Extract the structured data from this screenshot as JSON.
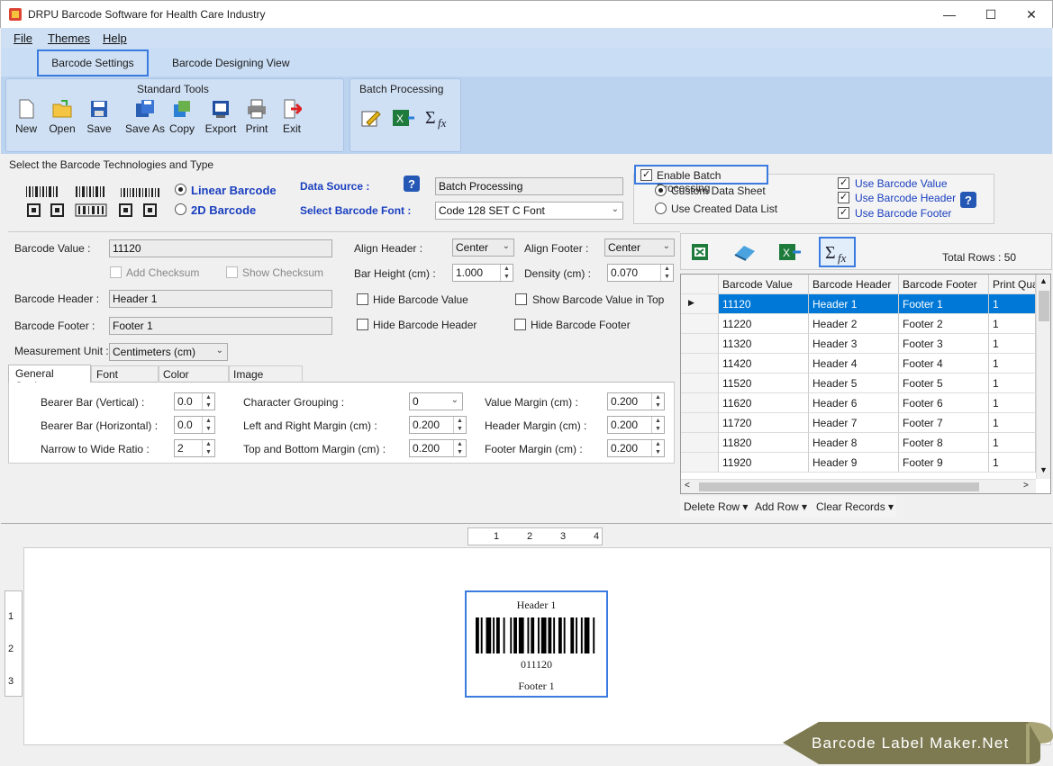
{
  "window": {
    "title": "DRPU Barcode Software for Health Care Industry",
    "min": "—",
    "max": "☐",
    "close": "✕"
  },
  "menu": [
    "File",
    "Themes",
    "Help"
  ],
  "tabs": {
    "barcode_settings": "Barcode Settings",
    "designing": "Barcode Designing View"
  },
  "ribbon": {
    "standard_title": "Standard Tools",
    "tools": [
      "New",
      "Open",
      "Save",
      "Save As",
      "Copy",
      "Export",
      "Print",
      "Exit"
    ],
    "batch_title": "Batch Processing"
  },
  "tech": {
    "title": "Select the Barcode Technologies and Type",
    "linear": "Linear Barcode",
    "twod": "2D Barcode",
    "data_source_label": "Data Source :",
    "data_source_value": "Batch Processing",
    "font_label": "Select Barcode Font :",
    "font_value": "Code 128 SET C Font"
  },
  "batch": {
    "enable": "Enable Batch Processing",
    "custom": "Custom Data Sheet",
    "created": "Use Created Data List",
    "use_value": "Use Barcode Value",
    "use_header": "Use Barcode Header",
    "use_footer": "Use Barcode Footer"
  },
  "form": {
    "value_label": "Barcode Value :",
    "value": "11120",
    "add_checksum": "Add Checksum",
    "show_checksum": "Show Checksum",
    "header_label": "Barcode Header :",
    "header": "Header 1",
    "footer_label": "Barcode Footer :",
    "footer": "Footer 1",
    "unit_label": "Measurement Unit :",
    "unit": "Centimeters (cm)",
    "align_header_label": "Align Header :",
    "align_header": "Center",
    "align_footer_label": "Align Footer :",
    "align_footer": "Center",
    "bar_height_label": "Bar Height (cm) :",
    "bar_height": "1.000",
    "density_label": "Density (cm) :",
    "density": "0.070",
    "hide_value": "Hide Barcode Value",
    "show_value_top": "Show Barcode Value in Top",
    "hide_header": "Hide Barcode Header",
    "hide_footer": "Hide Barcode Footer"
  },
  "subtabs": [
    "General Settings",
    "Font Settings",
    "Color Settings",
    "Image Settings"
  ],
  "general": {
    "bearer_v_label": "Bearer Bar (Vertical) :",
    "bearer_v": "0.0",
    "bearer_h_label": "Bearer Bar (Horizontal) :",
    "bearer_h": "0.0",
    "ratio_label": "Narrow to Wide Ratio :",
    "ratio": "2",
    "grouping_label": "Character Grouping :",
    "grouping": "0",
    "lr_label": "Left and Right Margin (cm) :",
    "lr": "0.200",
    "tb_label": "Top and Bottom Margin (cm) :",
    "tb": "0.200",
    "vm_label": "Value Margin (cm) :",
    "vm": "0.200",
    "hm_label": "Header Margin (cm) :",
    "hm": "0.200",
    "fm_label": "Footer Margin (cm) :",
    "fm": "0.200"
  },
  "grid": {
    "total": "Total Rows : 50",
    "columns": [
      "Barcode Value",
      "Barcode Header",
      "Barcode Footer",
      "Print Qua"
    ],
    "rows": [
      [
        "11120",
        "Header 1",
        "Footer 1",
        "1"
      ],
      [
        "11220",
        "Header 2",
        "Footer 2",
        "1"
      ],
      [
        "11320",
        "Header 3",
        "Footer 3",
        "1"
      ],
      [
        "11420",
        "Header 4",
        "Footer 4",
        "1"
      ],
      [
        "11520",
        "Header 5",
        "Footer 5",
        "1"
      ],
      [
        "11620",
        "Header 6",
        "Footer 6",
        "1"
      ],
      [
        "11720",
        "Header 7",
        "Footer 7",
        "1"
      ],
      [
        "11820",
        "Header 8",
        "Footer 8",
        "1"
      ],
      [
        "11920",
        "Header 9",
        "Footer 9",
        "1"
      ]
    ],
    "delete_row": "Delete Row",
    "add_row": "Add Row",
    "clear": "Clear Records"
  },
  "preview": {
    "ruler_h": [
      "1",
      "2",
      "3",
      "4"
    ],
    "ruler_v": [
      "1",
      "2",
      "3"
    ],
    "header": "Header 1",
    "value": "011120",
    "footer": "Footer 1"
  },
  "banner": "Barcode Label Maker.Net"
}
